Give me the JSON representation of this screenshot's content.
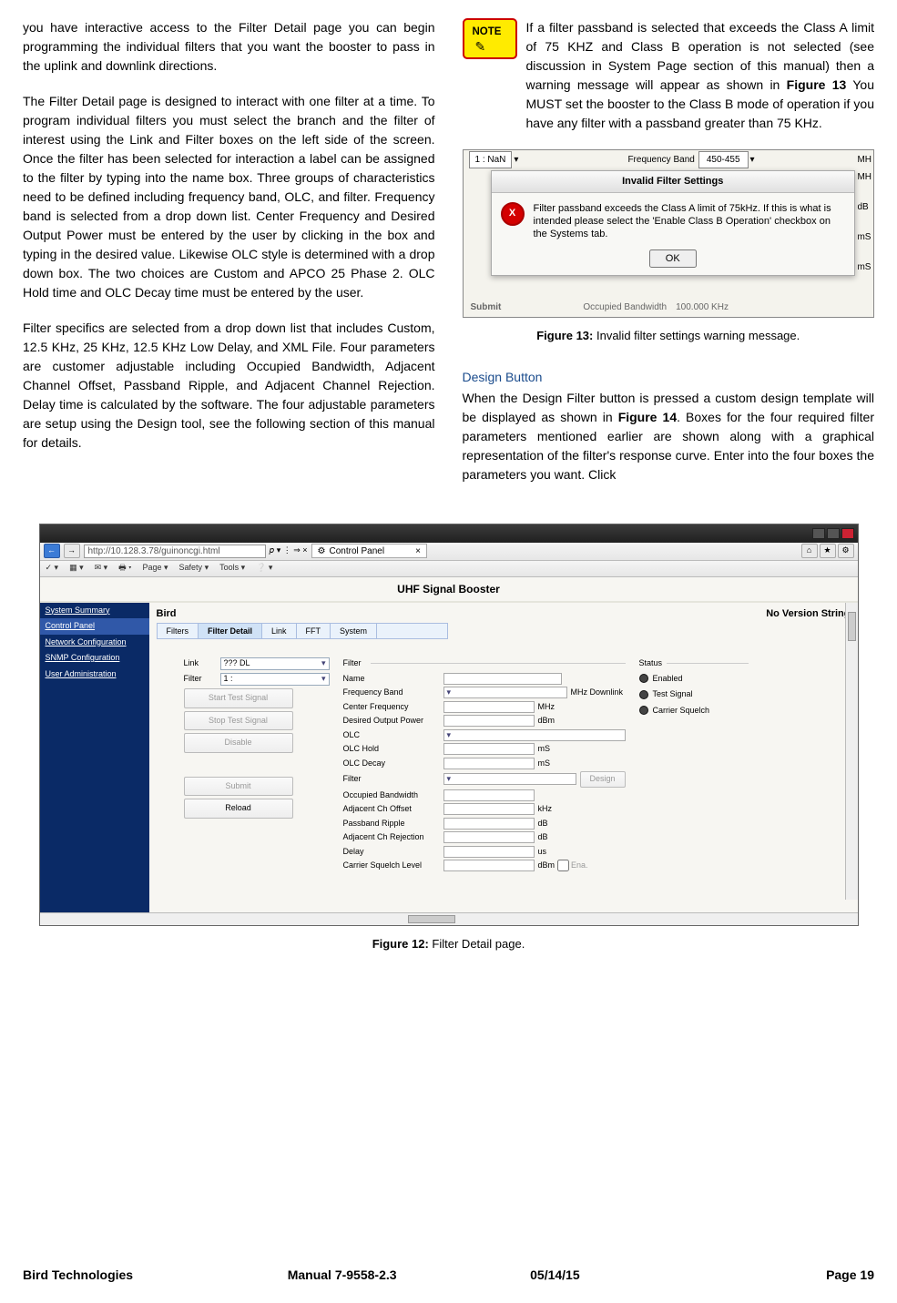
{
  "left_col": {
    "p1": "you have interactive access to the Filter Detail page you can begin programming the individual filters that you want the booster to pass in the uplink and downlink directions.",
    "p2": "The Filter Detail page is designed to interact with one filter at a time. To program individual filters you must select the branch and the filter of interest using the Link and Filter boxes on the left side of the screen. Once the filter has been selected for interaction a label can be assigned to the filter by typing into the name box. Three groups of characteristics need to be defined including frequency band, OLC, and filter. Frequency band is selected from a drop down list. Center Frequency and Desired Output Power must be entered by the user by clicking in the box and typing in the desired value. Likewise OLC style is determined with a drop down box. The two choices are Custom and APCO 25 Phase 2. OLC Hold time and OLC Decay time must be entered by the user.",
    "p3": "Filter specifics are selected from a drop down list that includes Custom, 12.5 KHz, 25 KHz, 12.5 KHz Low Delay, and XML File. Four parameters are customer adjustable including Occupied Bandwidth, Adjacent Channel Offset, Passband Ripple, and Adjacent Channel Rejection. Delay time is calculated by the software. The four adjustable parameters are setup using the Design tool, see the following section of this manual for details."
  },
  "note_text1": "If a filter passband is selected that exceeds the Class A limit of 75 KHZ and Class B operation is not selected (see discussion in System Page section of this manual) then a warning message will appear as shown in ",
  "note_fig_ref": "Figure 13",
  "note_text2": " You MUST set the booster to the Class B mode of operation if you have any filter with a passband greater than 75 KHz.",
  "fig13": {
    "top_nan": "1 : NaN",
    "freq_label": "Frequency Band",
    "freq_sel": "450-455",
    "right_mh": "MH",
    "right_db": "dB",
    "right_ms1": "mS",
    "right_ms2": "mS",
    "dialog_title": "Invalid Filter Settings",
    "dialog_msg": "Filter passband exceeds the Class A limit of 75kHz. If this is what is intended please select the 'Enable Class B Operation' checkbox on the Systems tab.",
    "ok": "OK",
    "submit": "Submit",
    "occ_bw": "Occupied Bandwidth",
    "occ_val": "100.000 KHz",
    "caption_lead": "Figure 13:",
    "caption_text": " Invalid filter settings warning message."
  },
  "design_head": "Design Button",
  "design_body1": "When the Design Filter button is pressed a custom design template will be displayed as shown in ",
  "design_fig_ref": "Figure 14",
  "design_body2": ". Boxes for the four required filter parameters mentioned earlier are shown along with a graphical representation of the filter's response curve. Enter into the four boxes the parameters you want. Click",
  "fig12": {
    "url": "http://10.128.3.78/guinoncgi.html",
    "search_ph": "𝘱 ▾ ⋮ ⇒ ×",
    "tab_label": "Control Panel",
    "tb_page": "Page",
    "tb_safety": "Safety",
    "tb_tools": "Tools",
    "page_title": "UHF Signal Booster",
    "sidebar": [
      "System Summary",
      "Control Panel",
      "Network Configuration",
      "SNMP Configuration",
      "User Administration"
    ],
    "brand": "Bird",
    "no_ver": "No Version String",
    "tabs": [
      "Filters",
      "Filter Detail",
      "Link",
      "FFT",
      "System"
    ],
    "link_label": "Link",
    "link_sel": "??? DL",
    "filter_label": "Filter",
    "filter_sel": "1 :",
    "btn_start": "Start Test Signal",
    "btn_stop": "Stop Test Signal",
    "btn_disable": "Disable",
    "btn_submit": "Submit",
    "btn_reload": "Reload",
    "fs_filter": "Filter",
    "rows": {
      "name": {
        "label": "Name",
        "unit": ""
      },
      "freq_band": {
        "label": "Frequency Band",
        "unit": "MHz Downlink"
      },
      "center_freq": {
        "label": "Center Frequency",
        "unit": "MHz"
      },
      "dop": {
        "label": "Desired Output Power",
        "unit": "dBm"
      },
      "olc": {
        "label": "OLC",
        "unit": ""
      },
      "olc_hold": {
        "label": "OLC Hold",
        "unit": "mS"
      },
      "olc_decay": {
        "label": "OLC Decay",
        "unit": "mS"
      },
      "filter": {
        "label": "Filter",
        "unit": "",
        "btn": "Design"
      },
      "occ_bw": {
        "label": "Occupied Bandwidth",
        "unit": ""
      },
      "ach_off": {
        "label": "Adjacent Ch Offset",
        "unit": "kHz"
      },
      "pb_ripple": {
        "label": "Passband Ripple",
        "unit": "dB"
      },
      "ach_rej": {
        "label": "Adjacent Ch Rejection",
        "unit": "dB"
      },
      "delay": {
        "label": "Delay",
        "unit": "us"
      },
      "csl": {
        "label": "Carrier Squelch Level",
        "unit": "dBm",
        "ena": "Ena."
      }
    },
    "fs_status": "Status",
    "status_items": [
      "Enabled",
      "Test Signal",
      "Carrier Squelch"
    ],
    "caption_lead": "Figure 12:",
    "caption_text": " Filter Detail page."
  },
  "footer": {
    "brand": "Bird Technologies",
    "manual": "Manual 7-9558-2.3",
    "date": "05/14/15",
    "page": "Page 19"
  }
}
